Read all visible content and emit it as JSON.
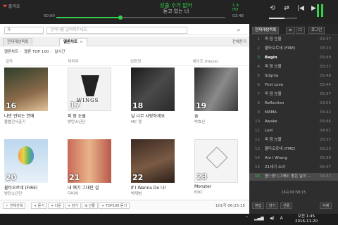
{
  "player": {
    "user_label": "즐겨요",
    "song_title": "상출 수가 없어",
    "song_artist": "듣고 있는 너",
    "time_elapsed": "00:00",
    "time_total": "03:48",
    "progress": 0.38,
    "tag_left": "1 A",
    "tag_right": "HD"
  },
  "search": {
    "scope": "곡",
    "placeholder": "검색어를 입력해주세요."
  },
  "tabs": [
    {
      "label": "현재재생목록"
    },
    {
      "label": "멜론차트"
    }
  ],
  "tab_settings": "전체듣기",
  "breadcrumb": [
    "멜론차트",
    "멜론 TOP 100",
    "실시간"
  ],
  "top_row": [
    "걸작",
    "마마무",
    "임창정",
    "헤이즈 (Heize)"
  ],
  "cards": [
    {
      "rank": "16",
      "title": "나만 안되는 연애",
      "artist": "볼빨간사춘기",
      "color": "#7c5c44"
    },
    {
      "rank": "17",
      "title": "피 땀 눈물",
      "artist": "방탄소년단",
      "color": "#f2f2f2"
    },
    {
      "rank": "18",
      "title": "날 너무 사랑하세요",
      "artist": "MC 몽",
      "color": "#3a3a3a"
    },
    {
      "rank": "19",
      "title": "숨",
      "artist": "박효신",
      "color": "#555555"
    },
    {
      "rank": "20",
      "title": "불타오르네 (FIRE)",
      "artist": "방탄소년단",
      "color": "#9ec3e6"
    },
    {
      "rank": "21",
      "title": "내 얘기 그대만 걸",
      "artist": "다비치",
      "color": "#d98a6a"
    },
    {
      "rank": "22",
      "title": "If I Wanna Do 나!",
      "artist": "박재범",
      "color": "#5a4a3a"
    },
    {
      "rank": "23",
      "title": "Monster",
      "artist": "EXO",
      "color": "#f4f4f4"
    }
  ],
  "toolbar": {
    "buttons": [
      "✓ 전체선택",
      "+ 듣기",
      "+ 다운",
      "+ 담기",
      "⊕ 선물",
      "+ TOP100 듣기"
    ],
    "count": "101곡  06:25:15"
  },
  "playlist": {
    "tabs": [
      "현재재생목록",
      "≡",
      "☐",
      "로그인"
    ],
    "items": [
      {
        "num": "1",
        "title": "피 땀 눈물",
        "dur": "03:37"
      },
      {
        "num": "2",
        "title": "불타오르네 (FIRE)",
        "dur": "03:23"
      },
      {
        "num": "3",
        "title": "Begin",
        "dur": "03:49"
      },
      {
        "num": "4",
        "title": "피 땀 눈물",
        "dur": "03:37"
      },
      {
        "num": "5",
        "title": "Stigma",
        "dur": "03:48"
      },
      {
        "num": "6",
        "title": "First Love",
        "dur": "03:44"
      },
      {
        "num": "7",
        "title": "피 땀 눈물",
        "dur": "03:37"
      },
      {
        "num": "8",
        "title": "Reflection",
        "dur": "03:55"
      },
      {
        "num": "9",
        "title": "MAMA",
        "dur": "03:42"
      },
      {
        "num": "10",
        "title": "Awake",
        "dur": "03:46"
      },
      {
        "num": "11",
        "title": "Lost",
        "dur": "04:01"
      },
      {
        "num": "12",
        "title": "피 땀 눈물",
        "dur": "03:37"
      },
      {
        "num": "13",
        "title": "불타오르네 (FIRE)",
        "dur": "03:23"
      },
      {
        "num": "14",
        "title": "Am I Wrong",
        "dur": "03:39"
      },
      {
        "num": "15",
        "title": "21세기 소녀",
        "dur": "03:47"
      },
      {
        "num": "16",
        "title": "봄! 셋! (그래도 좋은 날이 ...",
        "dur": "04:32"
      }
    ],
    "status": "16곡  00:58:15",
    "buttons": [
      "편집",
      "담기",
      "선물",
      "삭제"
    ]
  },
  "taskbar": {
    "time": "오전 1:45",
    "date": "2016-11-20",
    "ime": "A"
  },
  "colors": {
    "accent": "#35d04a"
  }
}
